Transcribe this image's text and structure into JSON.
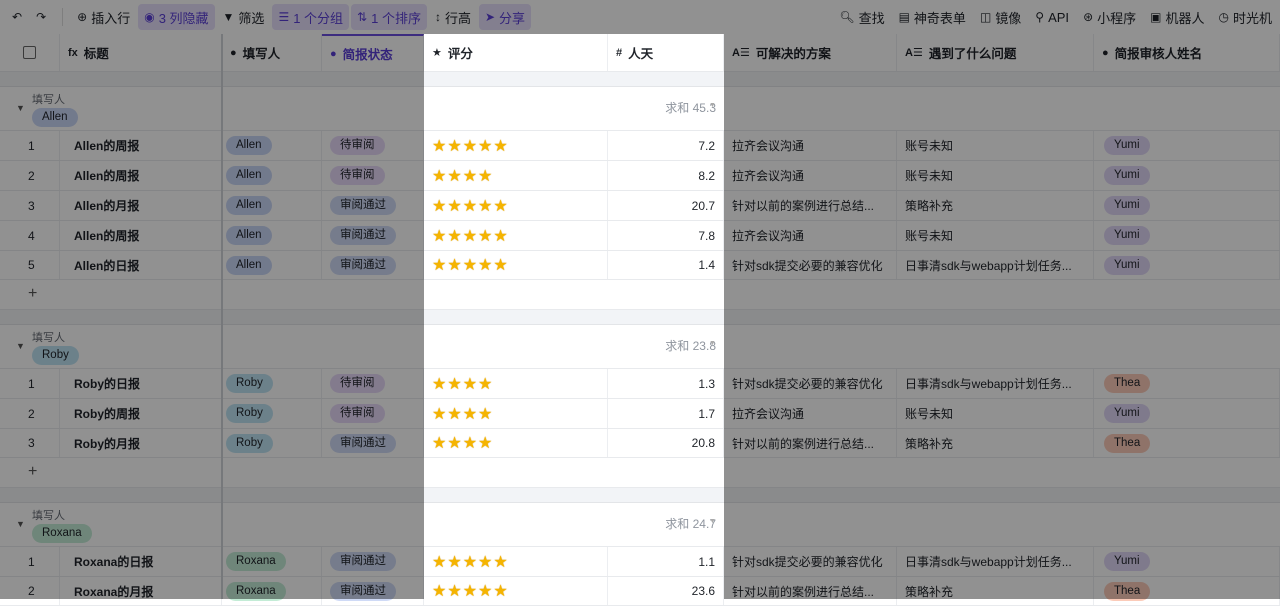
{
  "toolbar": {
    "left": [
      {
        "icon": "undo-icon",
        "g": "↶",
        "label": ""
      },
      {
        "icon": "redo-icon",
        "g": "↷",
        "label": ""
      },
      {
        "icon": "plus-circle-icon",
        "g": "⊕",
        "label": "插入行"
      },
      {
        "icon": "eye-icon",
        "g": "◉",
        "label": "3 列隐藏",
        "active": true
      },
      {
        "icon": "filter-icon",
        "g": "▼",
        "label": "筛选"
      },
      {
        "icon": "group-icon",
        "g": "☰",
        "label": "1 个分组",
        "active": true
      },
      {
        "icon": "sort-icon",
        "g": "⇅",
        "label": "1 个排序",
        "active": true
      },
      {
        "icon": "row-height-icon",
        "g": "↕",
        "label": "行高"
      },
      {
        "icon": "share-icon",
        "g": "➤",
        "label": "分享",
        "active": true
      }
    ],
    "right": [
      {
        "icon": "search-icon",
        "g": "🔍︎",
        "label": "查找"
      },
      {
        "icon": "form-icon",
        "g": "▤",
        "label": "神奇表单"
      },
      {
        "icon": "mirror-icon",
        "g": "◫",
        "label": "镜像"
      },
      {
        "icon": "api-icon",
        "g": "⚲",
        "label": "API"
      },
      {
        "icon": "mini-program-icon",
        "g": "⊛",
        "label": "小程序"
      },
      {
        "icon": "robot-icon",
        "g": "▣",
        "label": "机器人"
      },
      {
        "icon": "time-machine-icon",
        "g": "◷",
        "label": "时光机"
      }
    ]
  },
  "columns": [
    {
      "icon": "",
      "label": ""
    },
    {
      "icon": "fx",
      "label": "标题"
    },
    {
      "icon": "●",
      "label": "填写人"
    },
    {
      "icon": "●",
      "label": "简报状态"
    },
    {
      "icon": "★",
      "label": "评分"
    },
    {
      "icon": "#",
      "label": "人天"
    },
    {
      "icon": "A☰",
      "label": "可解决的方案"
    },
    {
      "icon": "A☰",
      "label": "遇到了什么问题"
    },
    {
      "icon": "●",
      "label": "简报审核人姓名"
    }
  ],
  "colors": {
    "accent": "#5b3fd6",
    "star": "#f5b400"
  },
  "group_field": "填写人",
  "groups": [
    {
      "name": "Allen",
      "color": "#c9d6f7",
      "sum": "求和 45.3",
      "rows": [
        {
          "n": "1",
          "title": "Allen的周报",
          "status": "待审阅",
          "stars": 5,
          "days": "7.2",
          "solution": "拉齐会议沟通",
          "problem": "账号未知",
          "reviewer": "Yumi"
        },
        {
          "n": "2",
          "title": "Allen的周报",
          "status": "待审阅",
          "stars": 4,
          "days": "8.2",
          "solution": "拉齐会议沟通",
          "problem": "账号未知",
          "reviewer": "Yumi"
        },
        {
          "n": "3",
          "title": "Allen的月报",
          "status": "审阅通过",
          "stars": 5,
          "days": "20.7",
          "solution": "针对以前的案例进行总结...",
          "problem": "策略补充",
          "reviewer": "Yumi"
        },
        {
          "n": "4",
          "title": "Allen的周报",
          "status": "审阅通过",
          "stars": 5,
          "days": "7.8",
          "solution": "拉齐会议沟通",
          "problem": "账号未知",
          "reviewer": "Yumi"
        },
        {
          "n": "5",
          "title": "Allen的日报",
          "status": "审阅通过",
          "stars": 5,
          "days": "1.4",
          "solution": "针对sdk提交必要的兼容优化",
          "problem": "日事清sdk与webapp计划任务...",
          "reviewer": "Yumi"
        }
      ]
    },
    {
      "name": "Roby",
      "color": "#bfe3f3",
      "sum": "求和 23.8",
      "rows": [
        {
          "n": "1",
          "title": "Roby的日报",
          "status": "待审阅",
          "stars": 4,
          "days": "1.3",
          "solution": "针对sdk提交必要的兼容优化",
          "problem": "日事清sdk与webapp计划任务...",
          "reviewer": "Thea"
        },
        {
          "n": "2",
          "title": "Roby的周报",
          "status": "待审阅",
          "stars": 4,
          "days": "1.7",
          "solution": "拉齐会议沟通",
          "problem": "账号未知",
          "reviewer": "Yumi"
        },
        {
          "n": "3",
          "title": "Roby的月报",
          "status": "审阅通过",
          "stars": 4,
          "days": "20.8",
          "solution": "针对以前的案例进行总结...",
          "problem": "策略补充",
          "reviewer": "Thea"
        }
      ]
    },
    {
      "name": "Roxana",
      "color": "#c3ecd6",
      "sum": "求和 24.7",
      "rows": [
        {
          "n": "1",
          "title": "Roxana的日报",
          "status": "审阅通过",
          "stars": 5,
          "days": "1.1",
          "solution": "针对sdk提交必要的兼容优化",
          "problem": "日事清sdk与webapp计划任务...",
          "reviewer": "Yumi"
        },
        {
          "n": "2",
          "title": "Roxana的月报",
          "status": "审阅通过",
          "stars": 5,
          "days": "23.6",
          "solution": "针对以前的案例进行总结...",
          "problem": "策略补充",
          "reviewer": "Thea"
        }
      ]
    }
  ],
  "status_colors": {
    "待审阅": "#e6d9f8",
    "审阅通过": "#cfdaf6"
  },
  "reviewer_colors": {
    "Yumi": "#e0d6f6",
    "Thea": "#fbcbb9"
  },
  "add_row": "+"
}
